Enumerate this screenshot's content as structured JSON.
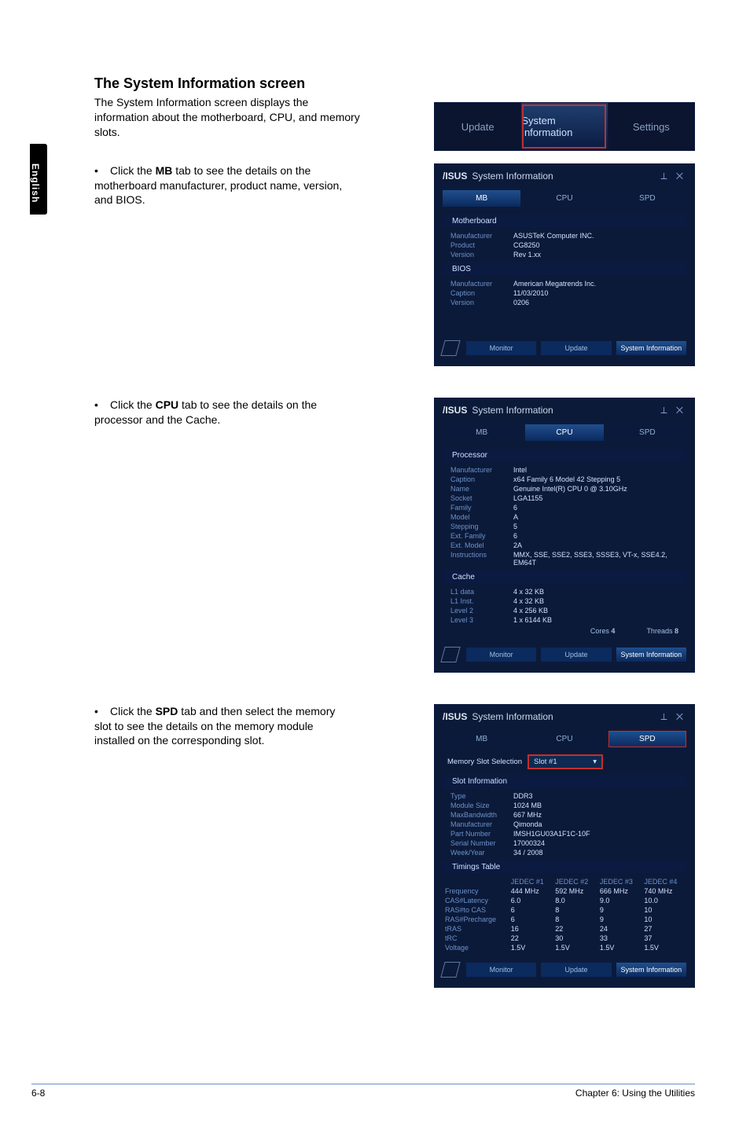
{
  "side_tab": "English",
  "heading": "The System Information screen",
  "intro": "The System Information screen displays the information about the motherboard, CPU, and memory slots.",
  "bullets": {
    "mb": {
      "pre": "Click the ",
      "bold": "MB",
      "post": " tab to see the details on the motherboard manufacturer, product name, version, and BIOS."
    },
    "cpu": {
      "pre": "Click the ",
      "bold": "CPU",
      "post": " tab to see the details on the processor and the Cache."
    },
    "spd": {
      "pre": "Click the ",
      "bold": "SPD",
      "post": " tab and then select the memory slot to see the details on the memory module installed on the corresponding slot."
    }
  },
  "top_tabbar": {
    "update": "Update",
    "system_info": "System Information",
    "settings": "Settings"
  },
  "panel_common": {
    "brand": "/ISUS",
    "title": "System Information",
    "win_icons": "⟂  ✕",
    "footer": {
      "monitor": "Monitor",
      "update": "Update",
      "sysinfo": "System Information"
    }
  },
  "panel_mb": {
    "tabs": {
      "mb": "MB",
      "cpu": "CPU",
      "spd": "SPD"
    },
    "sections": {
      "motherboard": {
        "header": "Motherboard",
        "rows": [
          {
            "k": "Manufacturer",
            "v": "ASUSTeK Computer INC."
          },
          {
            "k": "Product",
            "v": "CG8250"
          },
          {
            "k": "Version",
            "v": "Rev 1.xx"
          }
        ]
      },
      "bios": {
        "header": "BIOS",
        "rows": [
          {
            "k": "Manufacturer",
            "v": "American Megatrends Inc."
          },
          {
            "k": "Caption",
            "v": "11/03/2010"
          },
          {
            "k": "Version",
            "v": "0206"
          }
        ]
      }
    }
  },
  "panel_cpu": {
    "tabs": {
      "mb": "MB",
      "cpu": "CPU",
      "spd": "SPD"
    },
    "sections": {
      "processor": {
        "header": "Processor",
        "rows": [
          {
            "k": "Manufacturer",
            "v": "Intel"
          },
          {
            "k": "Caption",
            "v": "x64 Family 6 Model 42 Stepping 5"
          },
          {
            "k": "Name",
            "v": "Genuine Intel(R) CPU 0 @ 3.10GHz"
          },
          {
            "k": "Socket",
            "v": "LGA1155"
          },
          {
            "k": "Family",
            "v": "6"
          },
          {
            "k": "Model",
            "v": "A"
          },
          {
            "k": "Stepping",
            "v": "5"
          },
          {
            "k": "Ext. Family",
            "v": "6"
          },
          {
            "k": "Ext. Model",
            "v": "2A"
          },
          {
            "k": "Instructions",
            "v": "MMX, SSE, SSE2, SSE3, SSSE3, VT-x, SSE4.2, EM64T"
          }
        ]
      },
      "cache": {
        "header": "Cache",
        "rows": [
          {
            "k": "L1 data",
            "v": "4 x 32 KB"
          },
          {
            "k": "L1 Inst.",
            "v": "4 x 32 KB"
          },
          {
            "k": "Level 2",
            "v": "4 x 256 KB"
          },
          {
            "k": "Level 3",
            "v": "1 x 6144 KB"
          }
        ]
      },
      "cores_threads": {
        "cores_label": "Cores",
        "cores_val": "4",
        "threads_label": "Threads",
        "threads_val": "8"
      }
    }
  },
  "panel_spd": {
    "tabs": {
      "mb": "MB",
      "cpu": "CPU",
      "spd": "SPD"
    },
    "slot_sel": {
      "label": "Memory Slot Selection",
      "value": "Slot #1",
      "arrow": "▾"
    },
    "sections": {
      "slot_info": {
        "header": "Slot Information",
        "rows": [
          {
            "k": "Type",
            "v": "DDR3"
          },
          {
            "k": "Module Size",
            "v": "1024 MB"
          },
          {
            "k": "MaxBandwidth",
            "v": "667 MHz"
          },
          {
            "k": "Manufacturer",
            "v": "Qimonda"
          },
          {
            "k": "Part Number",
            "v": "IMSH1GU03A1F1C-10F"
          },
          {
            "k": "Serial Number",
            "v": "17000324"
          },
          {
            "k": "Week/Year",
            "v": "34 / 2008"
          }
        ]
      },
      "timings": {
        "header": "Timings Table",
        "columns": [
          "",
          "JEDEC #1",
          "JEDEC #2",
          "JEDEC #3",
          "JEDEC #4"
        ],
        "rows": [
          {
            "k": "Frequency",
            "v1": "444 MHz",
            "v2": "592 MHz",
            "v3": "666 MHz",
            "v4": "740 MHz"
          },
          {
            "k": "CAS#Latency",
            "v1": "6.0",
            "v2": "8.0",
            "v3": "9.0",
            "v4": "10.0"
          },
          {
            "k": "RAS#to CAS",
            "v1": "6",
            "v2": "8",
            "v3": "9",
            "v4": "10"
          },
          {
            "k": "RAS#Precharge",
            "v1": "6",
            "v2": "8",
            "v3": "9",
            "v4": "10"
          },
          {
            "k": "tRAS",
            "v1": "16",
            "v2": "22",
            "v3": "24",
            "v4": "27"
          },
          {
            "k": "tRC",
            "v1": "22",
            "v2": "30",
            "v3": "33",
            "v4": "37"
          },
          {
            "k": "Voltage",
            "v1": "1.5V",
            "v2": "1.5V",
            "v3": "1.5V",
            "v4": "1.5V"
          }
        ]
      }
    }
  },
  "footer": {
    "left": "6-8",
    "right": "Chapter 6: Using the Utilities"
  }
}
